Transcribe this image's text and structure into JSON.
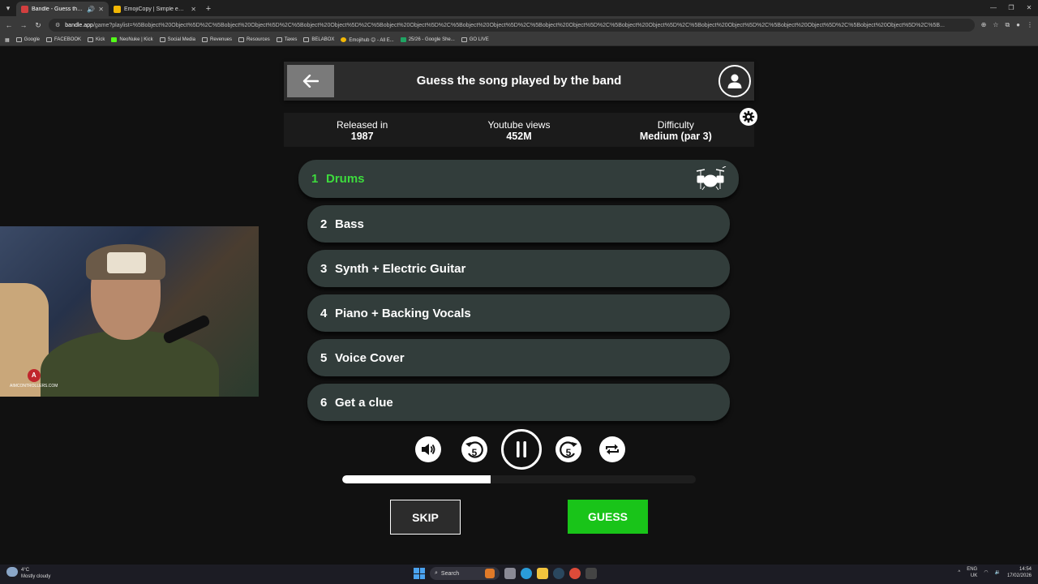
{
  "browser": {
    "tabs": [
      {
        "title": "Bandle - Guess the song, one...",
        "active": true,
        "favicon_color": "#d23f3f"
      },
      {
        "title": "EmojiCopy | Simple emoji copy...",
        "active": false,
        "favicon_color": "#f2b705"
      }
    ],
    "new_tab": "+",
    "address": {
      "host": "bandle.app",
      "path": "/game?playlist=%5Bobject%20Object%5D%2C%5Bobject%20Object%5D%2C%5Bobject%20Object%5D%2C%5Bobject%20Object%5D%2C%5Bobject%20Object%5D%2C%5Bobject%20Object%5D%2C%5Bobject%20Object%5D%2C%5Bobject%20Object%5D%2C%5Bobject%20Object%5D%2C%5Bobject%20Object%5D%2C%5B..."
    },
    "bookmarks": [
      "Google",
      "FACEBOOK",
      "Kick",
      "NeoNuke | Kick",
      "Social Media",
      "Revenues",
      "Resources",
      "Taxes",
      "BELABOX",
      "Emojihub 😊 - All E...",
      "25/26 - Google She...",
      "GO LIVE"
    ]
  },
  "game": {
    "title": "Guess the song played by the band",
    "info": [
      {
        "label": "Released in",
        "value": "1987"
      },
      {
        "label": "Youtube views",
        "value": "452M"
      },
      {
        "label": "Difficulty",
        "value": "Medium (par 3)"
      }
    ],
    "steps": [
      {
        "num": "1",
        "label": "Drums",
        "active": true
      },
      {
        "num": "2",
        "label": "Bass",
        "active": false
      },
      {
        "num": "3",
        "label": "Synth + Electric Guitar",
        "active": false
      },
      {
        "num": "4",
        "label": "Piano + Backing Vocals",
        "active": false
      },
      {
        "num": "5",
        "label": "Voice Cover",
        "active": false
      },
      {
        "num": "6",
        "label": "Get a clue",
        "active": false
      }
    ],
    "rewind_seconds": "5",
    "forward_seconds": "5",
    "progress": 0.42,
    "skip_label": "SKIP",
    "guess_label": "GUESS",
    "colors": {
      "active_step": "#3ddc3d",
      "guess": "#19c419",
      "step_bg": "#323d3b"
    }
  },
  "webcam": {
    "watermark": "AIMCONTROLLERS.COM"
  },
  "taskbar": {
    "temperature": "4°C",
    "weather": "Mostly cloudy",
    "search": "Search",
    "language": "ENG",
    "region": "UK",
    "time": "14:54",
    "date": "17/02/2026"
  }
}
